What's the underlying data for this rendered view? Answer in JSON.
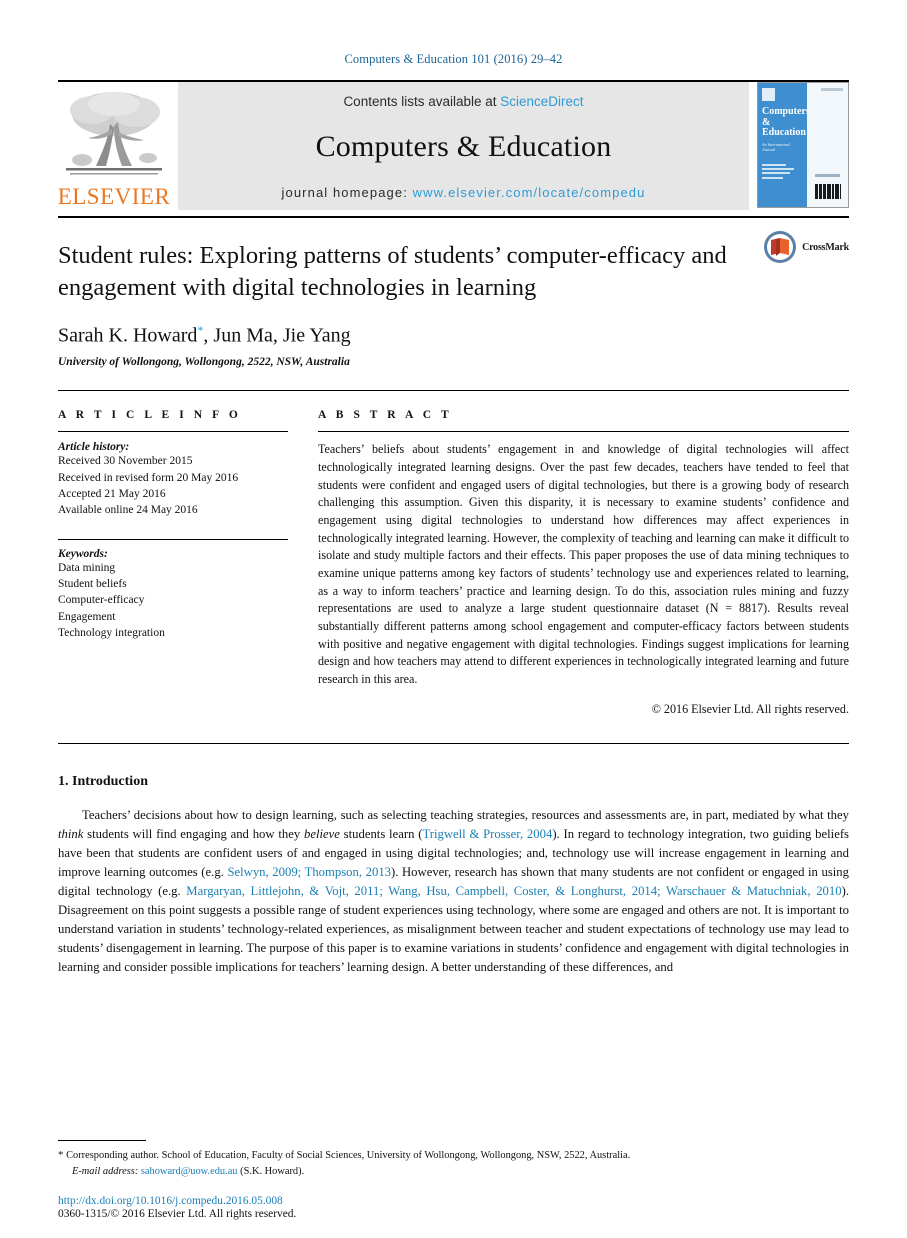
{
  "running_head": "Computers & Education 101 (2016) 29–42",
  "masthead": {
    "publisher_name": "ELSEVIER",
    "publisher_logo_icon": "elsevier-tree-icon",
    "contents_prefix": "Contents lists available at ",
    "contents_link": "ScienceDirect",
    "journal_name": "Computers & Education",
    "homepage_prefix": "journal homepage: ",
    "homepage_url": "www.elsevier.com/locate/compedu",
    "cover": {
      "title_line1": "Computers",
      "title_amp": "&",
      "title_line2": "Education",
      "subtitle": "An International Journal"
    }
  },
  "title_block": {
    "title": "Student rules: Exploring patterns of students’ computer-efficacy and engagement with digital technologies in learning",
    "authors_part1": "Sarah K. Howard",
    "authors_marker": "*",
    "authors_part2": ", Jun Ma, Jie Yang",
    "affiliation": "University of Wollongong, Wollongong, 2522, NSW, Australia",
    "crossmark_label": "CrossMark",
    "crossmark_icon": "crossmark-icon"
  },
  "article_info": {
    "heading": "A R T I C L E  I N F O",
    "history_label": "Article history:",
    "history": [
      "Received 30 November 2015",
      "Received in revised form 20 May 2016",
      "Accepted 21 May 2016",
      "Available online 24 May 2016"
    ],
    "keywords_label": "Keywords:",
    "keywords": [
      "Data mining",
      "Student beliefs",
      "Computer-efficacy",
      "Engagement",
      "Technology integration"
    ]
  },
  "abstract": {
    "heading": "A B S T R A C T",
    "text": "Teachers’ beliefs about students’ engagement in and knowledge of digital technologies will affect technologically integrated learning designs. Over the past few decades, teachers have tended to feel that students were confident and engaged users of digital technologies, but there is a growing body of research challenging this assumption. Given this disparity, it is necessary to examine students’ confidence and engagement using digital technologies to understand how differences may affect experiences in technologically integrated learning. However, the complexity of teaching and learning can make it difficult to isolate and study multiple factors and their effects. This paper proposes the use of data mining techniques to examine unique patterns among key factors of students’ technology use and experiences related to learning, as a way to inform teachers’ practice and learning design. To do this, association rules mining and fuzzy representations are used to analyze a large student questionnaire dataset (N = 8817). Results reveal substantially different patterns among school engagement and computer-efficacy factors between students with positive and negative engagement with digital technologies. Findings suggest implications for learning design and how teachers may attend to different experiences in technologically integrated learning and future research in this area.",
    "copyright": "© 2016 Elsevier Ltd. All rights reserved."
  },
  "body": {
    "section_number_title": "1. Introduction",
    "paragraph_1_a": "Teachers’ decisions about how to design learning, such as selecting teaching strategies, resources and assessments are, in part, mediated by what they ",
    "paragraph_1_em1": "think",
    "paragraph_1_b": " students will find engaging and how they ",
    "paragraph_1_em2": "believe",
    "paragraph_1_c": " students learn (",
    "cite_1": "Trigwell & Prosser, 2004",
    "paragraph_1_d": "). In regard to technology integration, two guiding beliefs have been that students are confident users of and engaged in using digital technologies; and, technology use will increase engagement in learning and improve learning outcomes (e.g. ",
    "cite_2": "Selwyn, 2009; Thompson, 2013",
    "paragraph_1_e": "). However, research has shown that many students are not confident or engaged in using digital technology (e.g. ",
    "cite_3": "Margaryan, Littlejohn, & Vojt, 2011; Wang, Hsu, Campbell, Coster, & Longhurst, 2014; Warschauer & Matuchniak, 2010",
    "paragraph_1_f": "). Disagreement on this point suggests a possible range of student experiences using technology, where some are engaged and others are not. It is important to understand variation in students’ technology-related experiences, as misalignment between teacher and student expectations of technology use may lead to students’ disengagement in learning. The purpose of this paper is to examine variations in students’ confidence and engagement with digital technologies in learning and consider possible implications for teachers’ learning design. A better understanding of these differences, and"
  },
  "footnotes": {
    "corresponding_marker": "*",
    "corresponding_text": " Corresponding author. School of Education, Faculty of Social Sciences, University of Wollongong, Wollongong, NSW, 2522, Australia.",
    "email_label": "E-mail address:",
    "email_link": "sahoward@uow.edu.au",
    "email_suffix": " (S.K. Howard).",
    "doi": "http://dx.doi.org/10.1016/j.compedu.2016.05.008",
    "issn_line": "0360-1315/© 2016 Elsevier Ltd. All rights reserved."
  },
  "colors": {
    "link_blue": "#1a7fb5",
    "masthead_link": "#2f9bd4",
    "elsevier_orange": "#E87722",
    "cover_blue": "#3f8fd0",
    "masthead_bg": "#e6e6e6"
  }
}
